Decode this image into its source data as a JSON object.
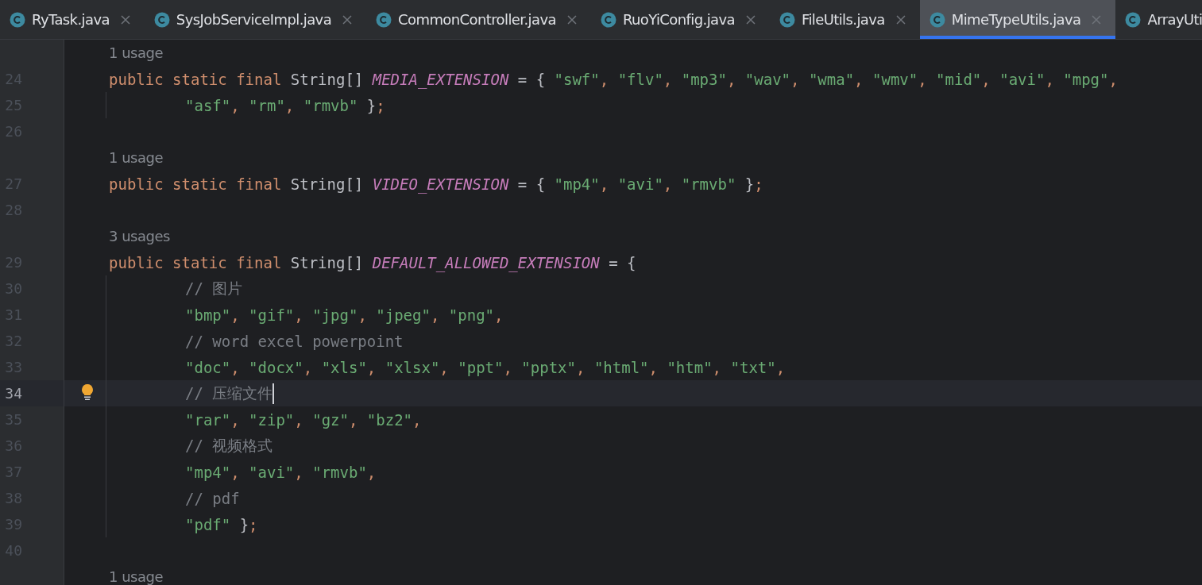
{
  "tabs": [
    {
      "label": "RyTask.java",
      "selected": false,
      "cut": false
    },
    {
      "label": "SysJobServiceImpl.java",
      "selected": false,
      "cut": false
    },
    {
      "label": "CommonController.java",
      "selected": false,
      "cut": false
    },
    {
      "label": "RuoYiConfig.java",
      "selected": false,
      "cut": false
    },
    {
      "label": "FileUtils.java",
      "selected": false,
      "cut": false
    },
    {
      "label": "MimeTypeUtils.java",
      "selected": true,
      "cut": false
    },
    {
      "label": "ArrayUti",
      "selected": false,
      "cut": true
    }
  ],
  "editor": {
    "lines": [
      {
        "kind": "usage",
        "text": "1 usage"
      },
      {
        "kind": "code",
        "number": "24",
        "continuation": false,
        "current": false,
        "tokens": [
          {
            "kind": "keyword",
            "text": "public static final"
          },
          {
            "kind": "plain",
            "text": " String[] "
          },
          {
            "kind": "field",
            "text": "MEDIA_EXTENSION"
          },
          {
            "kind": "plain",
            "text": " = { "
          },
          {
            "kind": "string",
            "text": "\"swf\""
          },
          {
            "kind": "comma",
            "text": ", "
          },
          {
            "kind": "string",
            "text": "\"flv\""
          },
          {
            "kind": "comma",
            "text": ", "
          },
          {
            "kind": "string",
            "text": "\"mp3\""
          },
          {
            "kind": "comma",
            "text": ", "
          },
          {
            "kind": "string",
            "text": "\"wav\""
          },
          {
            "kind": "comma",
            "text": ", "
          },
          {
            "kind": "string",
            "text": "\"wma\""
          },
          {
            "kind": "comma",
            "text": ", "
          },
          {
            "kind": "string",
            "text": "\"wmv\""
          },
          {
            "kind": "comma",
            "text": ", "
          },
          {
            "kind": "string",
            "text": "\"mid\""
          },
          {
            "kind": "comma",
            "text": ", "
          },
          {
            "kind": "string",
            "text": "\"avi\""
          },
          {
            "kind": "comma",
            "text": ", "
          },
          {
            "kind": "string",
            "text": "\"mpg\""
          },
          {
            "kind": "comma",
            "text": ","
          }
        ]
      },
      {
        "kind": "code",
        "number": "25",
        "continuation": true,
        "current": false,
        "tokens": [
          {
            "kind": "string",
            "text": "\"asf\""
          },
          {
            "kind": "comma",
            "text": ", "
          },
          {
            "kind": "string",
            "text": "\"rm\""
          },
          {
            "kind": "comma",
            "text": ", "
          },
          {
            "kind": "string",
            "text": "\"rmvb\""
          },
          {
            "kind": "plain",
            "text": " }"
          },
          {
            "kind": "comma",
            "text": ";"
          }
        ]
      },
      {
        "kind": "code",
        "number": "26",
        "continuation": false,
        "current": false
      },
      {
        "kind": "usage",
        "text": "1 usage"
      },
      {
        "kind": "code",
        "number": "27",
        "continuation": false,
        "current": false,
        "tokens": [
          {
            "kind": "keyword",
            "text": "public static final"
          },
          {
            "kind": "plain",
            "text": " String[] "
          },
          {
            "kind": "field",
            "text": "VIDEO_EXTENSION"
          },
          {
            "kind": "plain",
            "text": " = { "
          },
          {
            "kind": "string",
            "text": "\"mp4\""
          },
          {
            "kind": "comma",
            "text": ", "
          },
          {
            "kind": "string",
            "text": "\"avi\""
          },
          {
            "kind": "comma",
            "text": ", "
          },
          {
            "kind": "string",
            "text": "\"rmvb\""
          },
          {
            "kind": "plain",
            "text": " }"
          },
          {
            "kind": "comma",
            "text": ";"
          }
        ]
      },
      {
        "kind": "code",
        "number": "28",
        "continuation": false,
        "current": false
      },
      {
        "kind": "usage",
        "text": "3 usages"
      },
      {
        "kind": "code",
        "number": "29",
        "continuation": false,
        "current": false,
        "tokens": [
          {
            "kind": "keyword",
            "text": "public static final"
          },
          {
            "kind": "plain",
            "text": " String[] "
          },
          {
            "kind": "field",
            "text": "DEFAULT_ALLOWED_EXTENSION"
          },
          {
            "kind": "plain",
            "text": " = {"
          }
        ]
      },
      {
        "kind": "code",
        "number": "30",
        "continuation": true,
        "current": false,
        "tokens": [
          {
            "kind": "comment",
            "text": "// 图片"
          }
        ]
      },
      {
        "kind": "code",
        "number": "31",
        "continuation": true,
        "current": false,
        "tokens": [
          {
            "kind": "string",
            "text": "\"bmp\""
          },
          {
            "kind": "comma",
            "text": ", "
          },
          {
            "kind": "string",
            "text": "\"gif\""
          },
          {
            "kind": "comma",
            "text": ", "
          },
          {
            "kind": "string",
            "text": "\"jpg\""
          },
          {
            "kind": "comma",
            "text": ", "
          },
          {
            "kind": "string",
            "text": "\"jpeg\""
          },
          {
            "kind": "comma",
            "text": ", "
          },
          {
            "kind": "string",
            "text": "\"png\""
          },
          {
            "kind": "comma",
            "text": ","
          }
        ]
      },
      {
        "kind": "code",
        "number": "32",
        "continuation": true,
        "current": false,
        "tokens": [
          {
            "kind": "comment",
            "text": "// word excel powerpoint"
          }
        ]
      },
      {
        "kind": "code",
        "number": "33",
        "continuation": true,
        "current": false,
        "tokens": [
          {
            "kind": "string",
            "text": "\"doc\""
          },
          {
            "kind": "comma",
            "text": ", "
          },
          {
            "kind": "string",
            "text": "\"docx\""
          },
          {
            "kind": "comma",
            "text": ", "
          },
          {
            "kind": "string",
            "text": "\"xls\""
          },
          {
            "kind": "comma",
            "text": ", "
          },
          {
            "kind": "string",
            "text": "\"xlsx\""
          },
          {
            "kind": "comma",
            "text": ", "
          },
          {
            "kind": "string",
            "text": "\"ppt\""
          },
          {
            "kind": "comma",
            "text": ", "
          },
          {
            "kind": "string",
            "text": "\"pptx\""
          },
          {
            "kind": "comma",
            "text": ", "
          },
          {
            "kind": "string",
            "text": "\"html\""
          },
          {
            "kind": "comma",
            "text": ", "
          },
          {
            "kind": "string",
            "text": "\"htm\""
          },
          {
            "kind": "comma",
            "text": ", "
          },
          {
            "kind": "string",
            "text": "\"txt\""
          },
          {
            "kind": "comma",
            "text": ","
          }
        ]
      },
      {
        "kind": "code",
        "number": "34",
        "continuation": true,
        "current": true,
        "bulb": true,
        "caret": true,
        "tokens": [
          {
            "kind": "comment",
            "text": "// 压缩文件"
          }
        ]
      },
      {
        "kind": "code",
        "number": "35",
        "continuation": true,
        "current": false,
        "tokens": [
          {
            "kind": "string",
            "text": "\"rar\""
          },
          {
            "kind": "comma",
            "text": ", "
          },
          {
            "kind": "string",
            "text": "\"zip\""
          },
          {
            "kind": "comma",
            "text": ", "
          },
          {
            "kind": "string",
            "text": "\"gz\""
          },
          {
            "kind": "comma",
            "text": ", "
          },
          {
            "kind": "string",
            "text": "\"bz2\""
          },
          {
            "kind": "comma",
            "text": ","
          }
        ]
      },
      {
        "kind": "code",
        "number": "36",
        "continuation": true,
        "current": false,
        "tokens": [
          {
            "kind": "comment",
            "text": "// 视频格式"
          }
        ]
      },
      {
        "kind": "code",
        "number": "37",
        "continuation": true,
        "current": false,
        "tokens": [
          {
            "kind": "string",
            "text": "\"mp4\""
          },
          {
            "kind": "comma",
            "text": ", "
          },
          {
            "kind": "string",
            "text": "\"avi\""
          },
          {
            "kind": "comma",
            "text": ", "
          },
          {
            "kind": "string",
            "text": "\"rmvb\""
          },
          {
            "kind": "comma",
            "text": ","
          }
        ]
      },
      {
        "kind": "code",
        "number": "38",
        "continuation": true,
        "current": false,
        "tokens": [
          {
            "kind": "comment",
            "text": "// pdf"
          }
        ]
      },
      {
        "kind": "code",
        "number": "39",
        "continuation": true,
        "current": false,
        "tokens": [
          {
            "kind": "string",
            "text": "\"pdf\""
          },
          {
            "kind": "plain",
            "text": " }"
          },
          {
            "kind": "comma",
            "text": ";"
          }
        ]
      },
      {
        "kind": "code",
        "number": "40",
        "continuation": false,
        "current": false
      },
      {
        "kind": "usage",
        "text": "1 usage"
      }
    ]
  }
}
